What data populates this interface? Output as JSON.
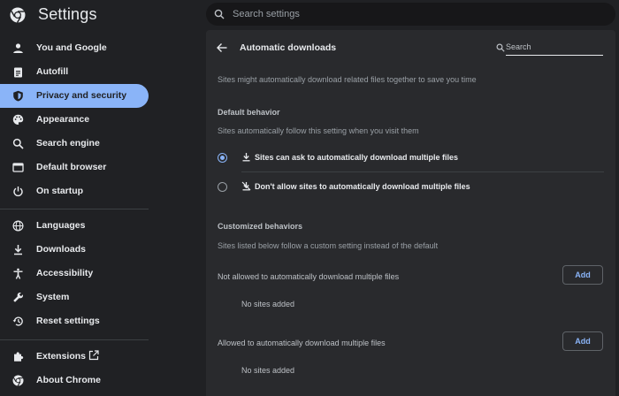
{
  "app": {
    "title": "Settings",
    "search_placeholder": "Search settings"
  },
  "sidebar": {
    "items": [
      {
        "label": "You and Google",
        "icon": "person-icon"
      },
      {
        "label": "Autofill",
        "icon": "clipboard-icon"
      },
      {
        "label": "Privacy and security",
        "icon": "shield-icon",
        "active": true
      },
      {
        "label": "Appearance",
        "icon": "palette-icon"
      },
      {
        "label": "Search engine",
        "icon": "search-icon"
      },
      {
        "label": "Default browser",
        "icon": "browser-icon"
      },
      {
        "label": "On startup",
        "icon": "power-icon"
      },
      {
        "label": "Languages",
        "icon": "globe-icon"
      },
      {
        "label": "Downloads",
        "icon": "download-icon"
      },
      {
        "label": "Accessibility",
        "icon": "accessibility-icon"
      },
      {
        "label": "System",
        "icon": "wrench-icon"
      },
      {
        "label": "Reset settings",
        "icon": "history-icon"
      },
      {
        "label": "Extensions",
        "icon": "puzzle-icon"
      },
      {
        "label": "About Chrome",
        "icon": "chrome-icon"
      }
    ]
  },
  "panel": {
    "title": "Automatic downloads",
    "search_placeholder": "Search",
    "intro": "Sites might automatically download related files together to save you time",
    "default_behavior": {
      "heading": "Default behavior",
      "description": "Sites automatically follow this setting when you visit them",
      "options": [
        {
          "label": "Sites can ask to automatically download multiple files",
          "icon": "download-icon",
          "selected": true
        },
        {
          "label": "Don't allow sites to automatically download multiple files",
          "icon": "download-off-icon",
          "selected": false
        }
      ]
    },
    "customized": {
      "heading": "Customized behaviors",
      "description": "Sites listed below follow a custom setting instead of the default",
      "not_allowed": {
        "label": "Not allowed to automatically download multiple files",
        "add_label": "Add",
        "empty_text": "No sites added"
      },
      "allowed": {
        "label": "Allowed to automatically download multiple files",
        "add_label": "Add",
        "empty_text": "No sites added"
      }
    }
  },
  "colors": {
    "accent": "#8ab4f8",
    "background": "#202124",
    "panel": "#292a2d"
  }
}
